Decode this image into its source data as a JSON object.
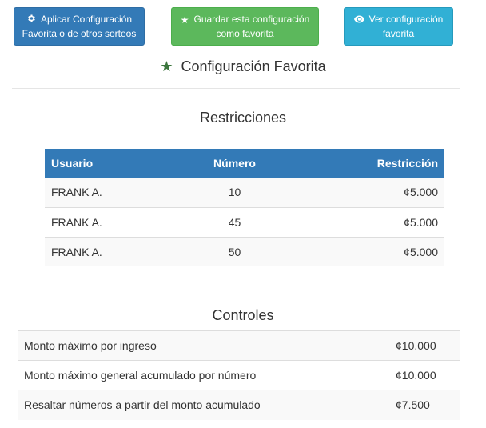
{
  "buttons": {
    "apply": {
      "line1": "Aplicar Configuración",
      "line2": "Favorita o de otros sorteos",
      "icon": "gear-icon",
      "color": "#337ab7"
    },
    "save": {
      "line1": "Guardar esta configuración",
      "line2": "como favorita",
      "icon": "star-icon",
      "color": "#5cb85c"
    },
    "view": {
      "line1": "Ver configuración",
      "line2": "favorita",
      "icon": "eye-icon",
      "color": "#31b0d5"
    }
  },
  "favorite": {
    "title": "Configuración Favorita",
    "icon": "star-icon",
    "icon_color": "#3c763d"
  },
  "restrictions": {
    "title": "Restricciones",
    "headers": {
      "user": "Usuario",
      "number": "Número",
      "restriction": "Restricción"
    },
    "header_color": "#337ab7",
    "rows": [
      {
        "user": "FRANK A.",
        "number": "10",
        "restriction": "¢5.000"
      },
      {
        "user": "FRANK A.",
        "number": "45",
        "restriction": "¢5.000"
      },
      {
        "user": "FRANK A.",
        "number": "50",
        "restriction": "¢5.000"
      }
    ]
  },
  "controls": {
    "title": "Controles",
    "rows": [
      {
        "label": "Monto máximo por ingreso",
        "value": "¢10.000"
      },
      {
        "label": "Monto máximo general acumulado por número",
        "value": "¢10.000"
      },
      {
        "label": "Resaltar números a partir del monto acumulado",
        "value": "¢7.500"
      }
    ]
  }
}
